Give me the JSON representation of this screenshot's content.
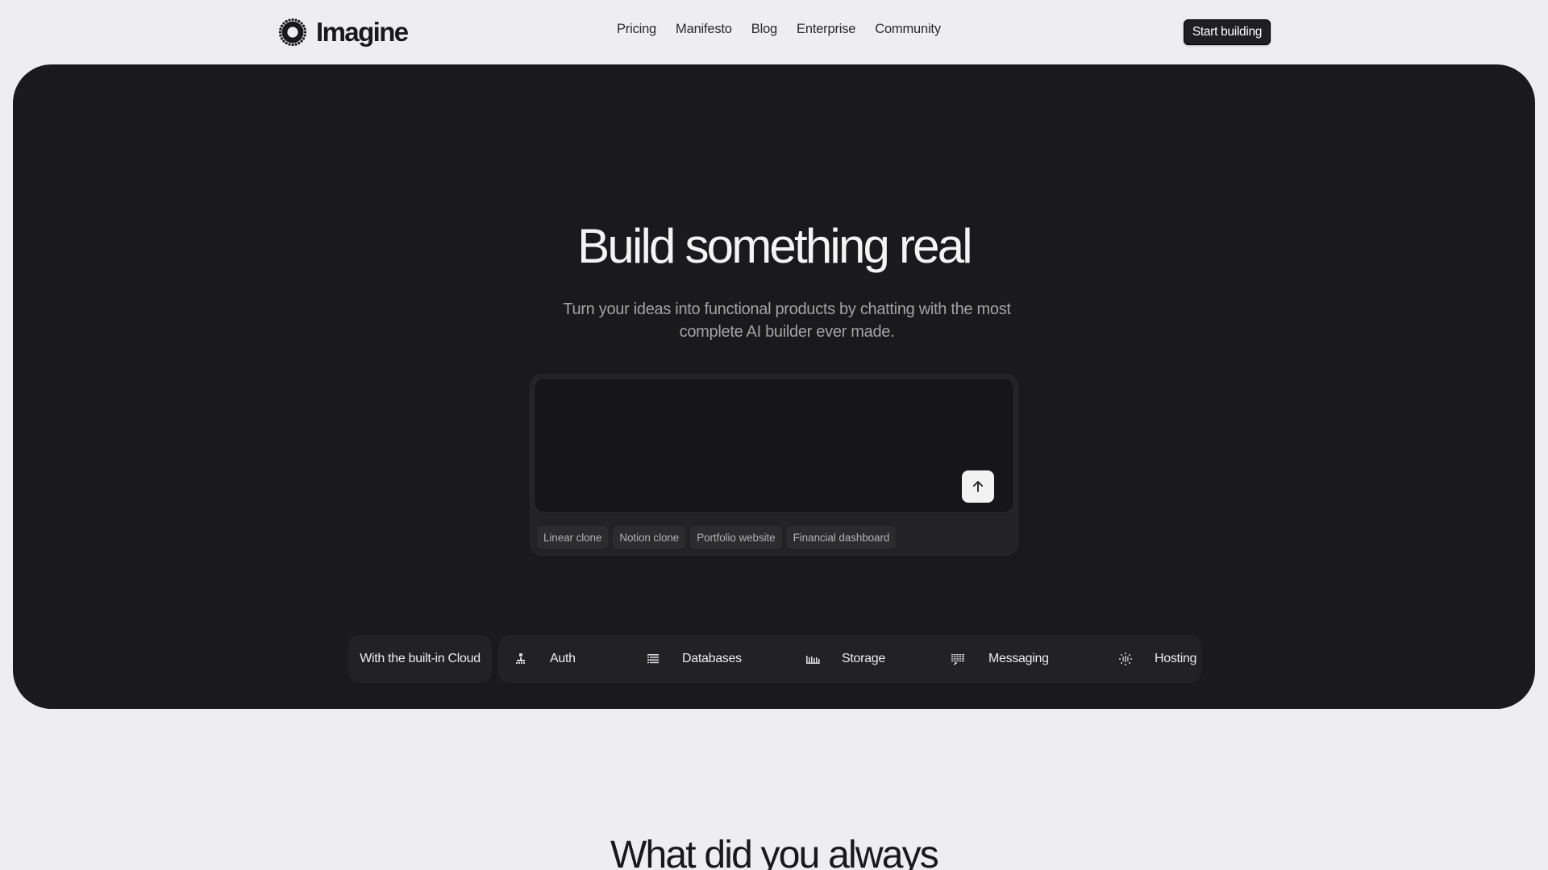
{
  "brand": {
    "name": "Imagine",
    "logo_icon": "sunburst-logo-icon"
  },
  "nav": {
    "items": [
      {
        "label": "Pricing"
      },
      {
        "label": "Manifesto"
      },
      {
        "label": "Blog"
      },
      {
        "label": "Enterprise"
      },
      {
        "label": "Community"
      }
    ],
    "cta_label": "Start building"
  },
  "hero": {
    "title": "Build something real",
    "subtitle": "Turn your ideas into functional products by chatting with the most complete AI builder ever made.",
    "prompt": {
      "value": "",
      "placeholder": "",
      "send_icon": "arrow-up-icon"
    },
    "suggestions": [
      {
        "label": "Linear clone"
      },
      {
        "label": "Notion clone"
      },
      {
        "label": "Portfolio website"
      },
      {
        "label": "Financial dashboard"
      }
    ],
    "cloud": {
      "label": "With the built-in Cloud",
      "features": [
        {
          "label": "Auth",
          "icon": "user-icon"
        },
        {
          "label": "Databases",
          "icon": "database-icon"
        },
        {
          "label": "Storage",
          "icon": "storage-icon"
        },
        {
          "label": "Messaging",
          "icon": "messaging-icon"
        },
        {
          "label": "Hosting",
          "icon": "globe-icon"
        }
      ]
    }
  },
  "next_section": {
    "title": "What did you always"
  },
  "colors": {
    "page_bg": "#eeeef0",
    "hero_bg": "#1a1a1c",
    "text_dark": "#19191b",
    "text_light": "#f4f4f5",
    "muted": "#a3a3a8"
  }
}
